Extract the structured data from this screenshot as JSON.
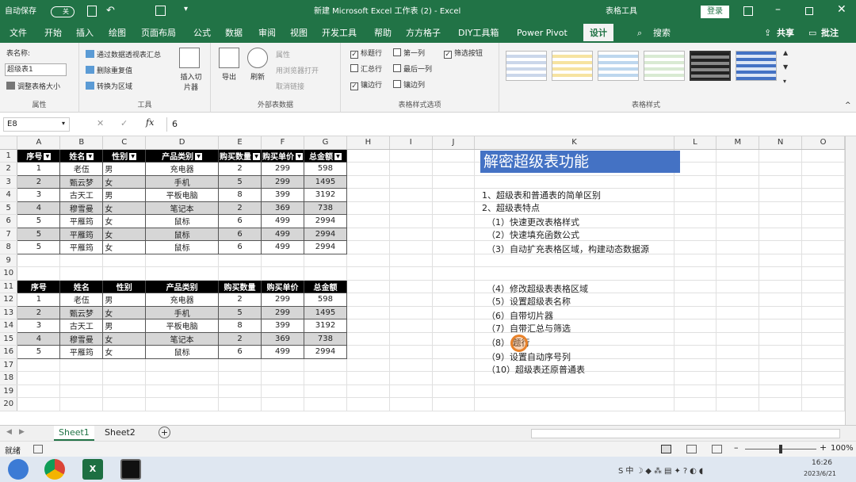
{
  "titlebar": {
    "autosave": "自动保存",
    "toggle": "关",
    "title": "新建 Microsoft Excel 工作表 (2) - Excel",
    "context": "表格工具",
    "login": "登录"
  },
  "tabs": [
    "文件",
    "开始",
    "插入",
    "绘图",
    "页面布局",
    "公式",
    "数据",
    "审阅",
    "视图",
    "开发工具",
    "帮助",
    "方方格子",
    "DIY工具箱",
    "Power Pivot",
    "设计",
    "搜索"
  ],
  "share": "共享",
  "comment": "批注",
  "ribbon": {
    "props": {
      "label": "表名称:",
      "value": "超级表1",
      "resize": "调整表格大小",
      "group": "属性"
    },
    "tools": {
      "pivot": "通过数据透视表汇总",
      "dedupe": "删除重复值",
      "convert": "转换为区域",
      "slicer": "插入切片器",
      "group": "工具"
    },
    "external": {
      "export": "导出",
      "refresh": "刷新",
      "props": "属性",
      "browser": "用浏览器打开",
      "unlink": "取消链接",
      "group": "外部表数据"
    },
    "options": {
      "header_row": "标题行",
      "first_col": "第一列",
      "filter_btn": "筛选按钮",
      "total_row": "汇总行",
      "last_col": "最后一列",
      "banded_rows": "镶边行",
      "banded_cols": "镶边列",
      "group": "表格样式选项"
    },
    "styles": {
      "group": "表格样式"
    }
  },
  "formula_bar": {
    "name_box": "E8",
    "value": "6"
  },
  "columns": [
    "A",
    "B",
    "C",
    "D",
    "E",
    "F",
    "G",
    "H",
    "I",
    "J",
    "K",
    "L",
    "M",
    "N",
    "O"
  ],
  "rows": [
    "1",
    "2",
    "3",
    "4",
    "5",
    "6",
    "7",
    "8",
    "9",
    "10",
    "11",
    "12",
    "13",
    "14",
    "15",
    "16",
    "17",
    "18",
    "19",
    "20"
  ],
  "table_headers": [
    "序号",
    "姓名",
    "性别",
    "产品类别",
    "购买数量",
    "购买单价",
    "总金额"
  ],
  "table1": [
    [
      "1",
      "老伍",
      "男",
      "充电器",
      "2",
      "299",
      "598"
    ],
    [
      "2",
      "甄云梦",
      "女",
      "手机",
      "5",
      "299",
      "1495"
    ],
    [
      "3",
      "古天工",
      "男",
      "平板电脑",
      "8",
      "399",
      "3192"
    ],
    [
      "4",
      "穆雪曼",
      "女",
      "笔记本",
      "2",
      "369",
      "738"
    ],
    [
      "5",
      "平雁筠",
      "女",
      "鼠标",
      "6",
      "499",
      "2994"
    ],
    [
      "5",
      "平雁筠",
      "女",
      "鼠标",
      "6",
      "499",
      "2994"
    ],
    [
      "5",
      "平雁筠",
      "女",
      "鼠标",
      "6",
      "499",
      "2994"
    ]
  ],
  "table2": [
    [
      "1",
      "老伍",
      "男",
      "充电器",
      "2",
      "299",
      "598"
    ],
    [
      "2",
      "甄云梦",
      "女",
      "手机",
      "5",
      "299",
      "1495"
    ],
    [
      "3",
      "古天工",
      "男",
      "平板电脑",
      "8",
      "399",
      "3192"
    ],
    [
      "4",
      "穆雪曼",
      "女",
      "笔记本",
      "2",
      "369",
      "738"
    ],
    [
      "5",
      "平雁筠",
      "女",
      "鼠标",
      "6",
      "499",
      "2994"
    ]
  ],
  "notes": {
    "title": "解密超级表功能",
    "lines": [
      "1、超级表和普通表的简单区别",
      "2、超级表特点",
      "（1）快速更改表格样式",
      "（2）快速填充函数公式",
      "（3）自动扩充表格区域，构建动态数据源",
      "（4）修改超级表表格区域",
      "（5）设置超级表名称",
      "（6）自带切片器",
      "（7）自带汇总与筛选",
      "（8）  题行",
      "（9）设置自动序号列",
      "（10）超级表还原普通表"
    ]
  },
  "sheets": [
    "Sheet1",
    "Sheet2"
  ],
  "status": {
    "ready": "就绪",
    "zoom": "100%"
  },
  "taskbar": {
    "time": "16:26",
    "date": "2023/6/21"
  }
}
